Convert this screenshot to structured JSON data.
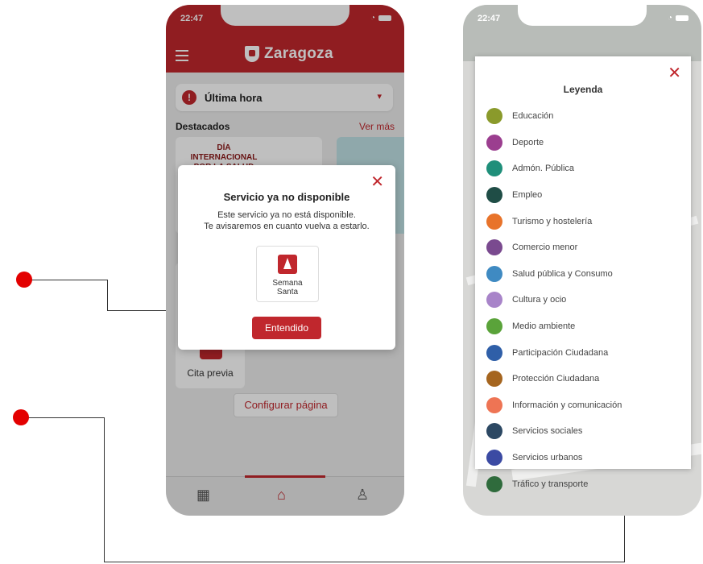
{
  "phone1": {
    "status": {
      "time": "22:47"
    },
    "header": {
      "brand": "Zaragoza"
    },
    "ultima_hora": {
      "label": "Última hora"
    },
    "destacados": {
      "title": "Destacados",
      "ver_mas": "Ver más",
      "card1_text": "DÍA INTERNACIONAL POR LA SALUD"
    },
    "cita_previa": {
      "label": "Cita previa"
    },
    "configurar": {
      "label": "Configurar página"
    },
    "modal": {
      "close": "✕",
      "title": "Servicio ya no disponible",
      "desc1": "Este servicio ya no está disponible.",
      "desc2": "Te avisaremos en cuanto vuelva a estarlo.",
      "service_label_1": "Semana",
      "service_label_2": "Santa",
      "ok": "Entendido"
    }
  },
  "phone2": {
    "status": {
      "time": "22:47"
    },
    "legend": {
      "close": "✕",
      "title": "Leyenda",
      "items": [
        {
          "label": "Educación",
          "color": "#8a9a2b",
          "icon": "book-icon"
        },
        {
          "label": "Deporte",
          "color": "#9b3e8f",
          "icon": "ball-icon"
        },
        {
          "label": "Admón. Pública",
          "color": "#1f8f7a",
          "icon": "building-icon"
        },
        {
          "label": "Empleo",
          "color": "#1f4d46",
          "icon": "briefcase-icon"
        },
        {
          "label": "Turismo y hostelería",
          "color": "#e8732a",
          "icon": "signpost-icon"
        },
        {
          "label": "Comercio menor",
          "color": "#7a4a8f",
          "icon": "basket-icon"
        },
        {
          "label": "Salud pública y Consumo",
          "color": "#3f8ac2",
          "icon": "heart-icon"
        },
        {
          "label": "Cultura y ocio",
          "color": "#a884c9",
          "icon": "masks-icon"
        },
        {
          "label": "Medio ambiente",
          "color": "#5aa33a",
          "icon": "leaf-icon"
        },
        {
          "label": "Participación Ciudadana",
          "color": "#2f5fa8",
          "icon": "people-icon"
        },
        {
          "label": "Protección Ciudadana",
          "color": "#a5651f",
          "icon": "person-walk-icon"
        },
        {
          "label": "Información y comunicación",
          "color": "#ee7454",
          "icon": "info-icon"
        },
        {
          "label": "Servicios sociales",
          "color": "#2c4863",
          "icon": "hands-icon"
        },
        {
          "label": "Servicios urbanos",
          "color": "#3b4aa3",
          "icon": "house-icon"
        },
        {
          "label": "Tráfico y transporte",
          "color": "#2f6b3c",
          "icon": "car-icon"
        }
      ]
    }
  }
}
